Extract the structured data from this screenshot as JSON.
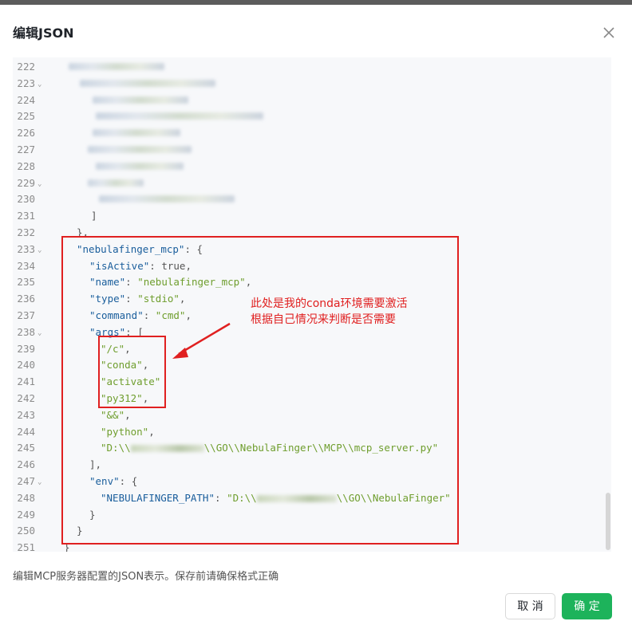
{
  "dialog": {
    "title": "编辑JSON",
    "close_icon": "close-icon",
    "hint": "编辑MCP服务器配置的JSON表示。保存前请确保格式正确",
    "cancel_label": "取 消",
    "ok_label": "确 定",
    "ok_color": "#1db35b"
  },
  "editor": {
    "lines": [
      {
        "n": "222",
        "fold": false,
        "parts": []
      },
      {
        "n": "223",
        "fold": true,
        "parts": []
      },
      {
        "n": "224",
        "fold": false,
        "parts": []
      },
      {
        "n": "225",
        "fold": false,
        "parts": []
      },
      {
        "n": "226",
        "fold": false,
        "parts": []
      },
      {
        "n": "227",
        "fold": false,
        "parts": []
      },
      {
        "n": "228",
        "fold": false,
        "parts": []
      },
      {
        "n": "229",
        "fold": true,
        "parts": []
      },
      {
        "n": "230",
        "fold": false,
        "parts": []
      },
      {
        "n": "231",
        "fold": false,
        "parts": [
          {
            "t": "]",
            "c": "pun"
          }
        ]
      },
      {
        "n": "232",
        "fold": false,
        "parts": [
          {
            "t": "},",
            "c": "pun"
          }
        ]
      },
      {
        "n": "233",
        "fold": true,
        "parts": [
          {
            "t": "\"nebulafinger_mcp\"",
            "c": "key"
          },
          {
            "t": ": {",
            "c": "pun"
          }
        ]
      },
      {
        "n": "234",
        "fold": false,
        "parts": [
          {
            "t": "\"isActive\"",
            "c": "key"
          },
          {
            "t": ": ",
            "c": "pun"
          },
          {
            "t": "true",
            "c": "bool"
          },
          {
            "t": ",",
            "c": "pun"
          }
        ]
      },
      {
        "n": "235",
        "fold": false,
        "parts": [
          {
            "t": "\"name\"",
            "c": "key"
          },
          {
            "t": ": ",
            "c": "pun"
          },
          {
            "t": "\"nebulafinger_mcp\"",
            "c": "str"
          },
          {
            "t": ",",
            "c": "pun"
          }
        ]
      },
      {
        "n": "236",
        "fold": false,
        "parts": [
          {
            "t": "\"type\"",
            "c": "key"
          },
          {
            "t": ": ",
            "c": "pun"
          },
          {
            "t": "\"stdio\"",
            "c": "str"
          },
          {
            "t": ",",
            "c": "pun"
          }
        ]
      },
      {
        "n": "237",
        "fold": false,
        "parts": [
          {
            "t": "\"command\"",
            "c": "key"
          },
          {
            "t": ": ",
            "c": "pun"
          },
          {
            "t": "\"cmd\"",
            "c": "str"
          },
          {
            "t": ",",
            "c": "pun"
          }
        ]
      },
      {
        "n": "238",
        "fold": true,
        "parts": [
          {
            "t": "\"args\"",
            "c": "key"
          },
          {
            "t": ": [",
            "c": "pun"
          }
        ]
      },
      {
        "n": "239",
        "fold": false,
        "parts": [
          {
            "t": "\"/c\"",
            "c": "str"
          },
          {
            "t": ",",
            "c": "pun"
          }
        ]
      },
      {
        "n": "240",
        "fold": false,
        "parts": [
          {
            "t": "\"conda\"",
            "c": "str"
          },
          {
            "t": ",",
            "c": "pun"
          }
        ]
      },
      {
        "n": "241",
        "fold": false,
        "parts": [
          {
            "t": "\"activate\"",
            "c": "str"
          }
        ]
      },
      {
        "n": "242",
        "fold": false,
        "parts": [
          {
            "t": "\"py312\"",
            "c": "str"
          },
          {
            "t": ",",
            "c": "pun"
          }
        ]
      },
      {
        "n": "243",
        "fold": false,
        "parts": [
          {
            "t": "\"&&\"",
            "c": "str"
          },
          {
            "t": ",",
            "c": "pun"
          }
        ]
      },
      {
        "n": "244",
        "fold": false,
        "parts": [
          {
            "t": "\"python\"",
            "c": "str"
          },
          {
            "t": ",",
            "c": "pun"
          }
        ]
      },
      {
        "n": "245",
        "fold": false,
        "parts": [
          {
            "t": "\"D:\\\\",
            "c": "str"
          },
          {
            "t": "\\\\GO\\\\NebulaFinger\\\\MCP\\\\mcp_server.py\"",
            "c": "str"
          }
        ]
      },
      {
        "n": "246",
        "fold": false,
        "parts": [
          {
            "t": "],",
            "c": "pun"
          }
        ]
      },
      {
        "n": "247",
        "fold": true,
        "parts": [
          {
            "t": "\"env\"",
            "c": "key"
          },
          {
            "t": ": {",
            "c": "pun"
          }
        ]
      },
      {
        "n": "248",
        "fold": false,
        "parts": [
          {
            "t": "\"NEBULAFINGER_PATH\"",
            "c": "key"
          },
          {
            "t": ": ",
            "c": "pun"
          },
          {
            "t": "\"D:\\\\",
            "c": "str"
          },
          {
            "t": "\\\\GO\\\\NebulaFinger\"",
            "c": "str"
          }
        ]
      },
      {
        "n": "249",
        "fold": false,
        "parts": [
          {
            "t": "}",
            "c": "pun"
          }
        ]
      },
      {
        "n": "250",
        "fold": false,
        "parts": [
          {
            "t": "}",
            "c": "pun"
          }
        ]
      },
      {
        "n": "251",
        "fold": false,
        "parts": [
          {
            "t": "}",
            "c": "pun"
          }
        ]
      }
    ]
  },
  "annotation": {
    "line1": "此处是我的conda环境需要激活",
    "line2": "根据自己情况来判断是否需要",
    "color": "#e02020"
  }
}
